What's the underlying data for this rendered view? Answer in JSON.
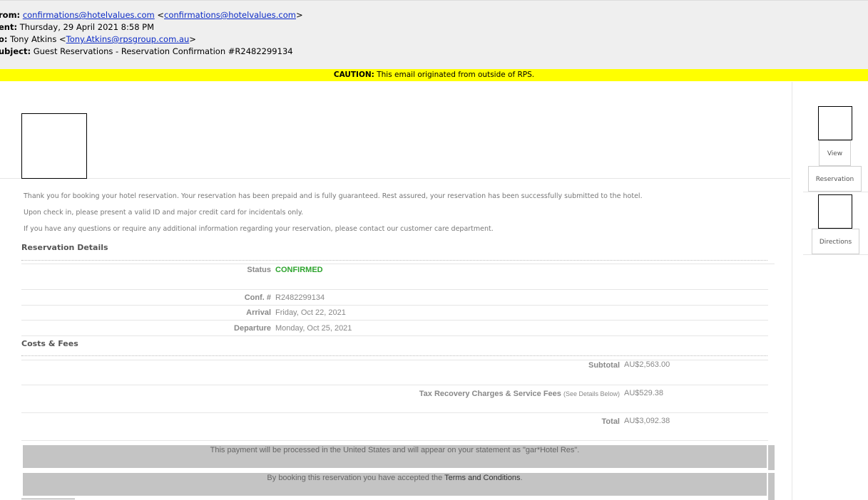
{
  "email_header": {
    "from_label": "rom:",
    "from_link": "confirmations@hotelvalues.com",
    "from_link2": "confirmations@hotelvalues.com",
    "sent_label": "ent:",
    "sent_value": "Thursday, 29 April 2021 8:58 PM",
    "to_label": "o:",
    "to_name": "Tony Atkins",
    "to_link": "Tony.Atkins@rpsgroup.com.au",
    "subject_label": "ubject:",
    "subject_value": "Guest Reservations - Reservation Confirmation #R2482299134"
  },
  "caution": {
    "label": "CAUTION:",
    "text": "This email originated from outside of RPS."
  },
  "intro": {
    "line1": "Thank you for booking your hotel reservation. Your reservation has been prepaid and is fully guaranteed. Rest assured, your reservation has been successfully submitted to the hotel.",
    "line2": "Upon check in, please present a valid ID and major credit card for incidentals only.",
    "line3": "If you have any questions or require any additional information regarding your reservation, please contact our customer care department."
  },
  "reservation": {
    "title": "Reservation Details",
    "status_label": "Status",
    "status_value": "CONFIRMED",
    "conf_label": "Conf. #",
    "conf_value": "R2482299134",
    "arrival_label": "Arrival",
    "arrival_value": "Friday, Oct 22, 2021",
    "departure_label": "Departure",
    "departure_value": "Monday, Oct 25, 2021"
  },
  "costs": {
    "title": "Costs & Fees",
    "subtotal_label": "Subtotal",
    "subtotal_value": "AU$2,563.00",
    "tax_label": "Tax Recovery Charges & Service Fees",
    "tax_note": "(See Details Below)",
    "tax_value": "AU$529.38",
    "total_label": "Total",
    "total_value": "AU$3,092.38"
  },
  "notices": {
    "payment": "This payment will be processed in the United States and will appear on your statement as \"gar*Hotel Res\".",
    "terms_prefix": "By booking this reservation you have accepted the",
    "terms_link": "Terms and Conditions",
    "terms_suffix": "."
  },
  "side": {
    "view_label": "View",
    "reservation_label": "Reservation",
    "directions_label": "Directions"
  }
}
